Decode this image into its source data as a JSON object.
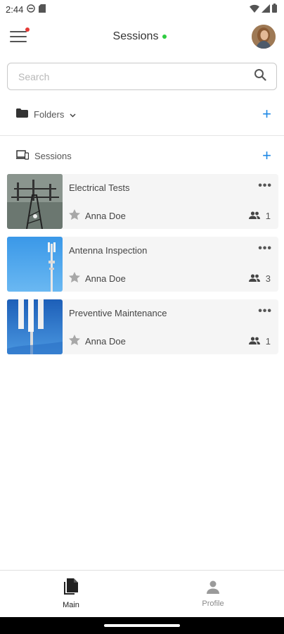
{
  "status_bar": {
    "time": "2:44",
    "icons": [
      "do-not-disturb-icon",
      "sd-card-icon",
      "wifi-icon",
      "signal-icon",
      "battery-icon"
    ]
  },
  "app_bar": {
    "title": "Sessions",
    "online_color": "#2ecc40",
    "notification_color": "#e53935"
  },
  "search": {
    "placeholder": "Search",
    "value": ""
  },
  "folders": {
    "label": "Folders",
    "add_label": "+"
  },
  "sessions_section": {
    "label": "Sessions",
    "add_label": "+"
  },
  "sessions": [
    {
      "title": "Electrical Tests",
      "owner": "Anna Doe",
      "participants": "1",
      "more": "•••"
    },
    {
      "title": "Antenna Inspection",
      "owner": "Anna Doe",
      "participants": "3",
      "more": "•••"
    },
    {
      "title": "Preventive Maintenance",
      "owner": "Anna Doe",
      "participants": "1",
      "more": "•••"
    }
  ],
  "bottom_nav": {
    "main_label": "Main",
    "profile_label": "Profile"
  },
  "colors": {
    "accent": "#1e88e5",
    "card_bg": "#f5f5f5"
  }
}
